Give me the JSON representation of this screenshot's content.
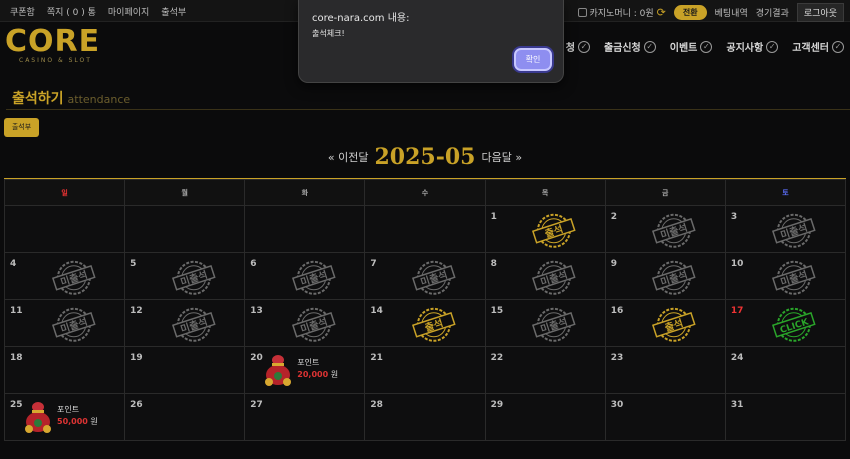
{
  "topbar": {
    "links": [
      "쿠폰함",
      "쪽지 ( 0 ) 통",
      "마이페이지",
      "출석부"
    ],
    "casino_money": "카지노머니 : 0원",
    "convert_label": "전환",
    "bet_history": "베팅내역",
    "game_results": "경기결과",
    "logout": "로그아웃"
  },
  "logo": {
    "main": "CORE",
    "sub": "CASINO & SLOT"
  },
  "nav": {
    "items": [
      "청",
      "출금신청",
      "이벤트",
      "공지사항",
      "고객센터"
    ]
  },
  "page": {
    "title_ko": "출석하기",
    "title_en": "attendance",
    "attend_button": "출석부"
  },
  "month_nav": {
    "prev": "« 이전달",
    "month": "2025-05",
    "next": "다음달 »"
  },
  "calendar": {
    "weekdays": [
      "일",
      "월",
      "화",
      "수",
      "목",
      "금",
      "토"
    ],
    "weeks": [
      [
        null,
        null,
        null,
        null,
        {
          "d": "1",
          "s": "출석"
        },
        {
          "d": "2",
          "s": "미출석"
        },
        {
          "d": "3",
          "s": "미출석"
        }
      ],
      [
        {
          "d": "4",
          "s": "미출석"
        },
        {
          "d": "5",
          "s": "미출석"
        },
        {
          "d": "6",
          "s": "미출석"
        },
        {
          "d": "7",
          "s": "미출석"
        },
        {
          "d": "8",
          "s": "미출석"
        },
        {
          "d": "9",
          "s": "미출석"
        },
        {
          "d": "10",
          "s": "미출석"
        }
      ],
      [
        {
          "d": "11",
          "s": "미출석"
        },
        {
          "d": "12",
          "s": "미출석"
        },
        {
          "d": "13",
          "s": "미출석"
        },
        {
          "d": "14",
          "s": "출석"
        },
        {
          "d": "15",
          "s": "미출석"
        },
        {
          "d": "16",
          "s": "출석"
        },
        {
          "d": "17",
          "s": "CLICK"
        }
      ],
      [
        {
          "d": "18"
        },
        {
          "d": "19"
        },
        {
          "d": "20",
          "reward": true
        },
        {
          "d": "21"
        },
        {
          "d": "22"
        },
        {
          "d": "23"
        },
        {
          "d": "24"
        }
      ],
      [
        {
          "d": "25",
          "reward": true
        },
        {
          "d": "26"
        },
        {
          "d": "27"
        },
        {
          "d": "28"
        },
        {
          "d": "29"
        },
        {
          "d": "30"
        },
        {
          "d": "31"
        }
      ]
    ]
  },
  "rewards": {
    "label": "포인트",
    "amount_20": "20,000",
    "amount_25": "50,000",
    "unit": "원"
  },
  "dialog": {
    "title": "core-nara.com 내용:",
    "message": "출석체크!",
    "ok": "확인"
  },
  "colors": {
    "gold": "#c9a227",
    "sunday": "#e33333",
    "saturday": "#5a6cf2",
    "click_green": "#2aa52a",
    "missed_gray": "#6a6a6a"
  }
}
